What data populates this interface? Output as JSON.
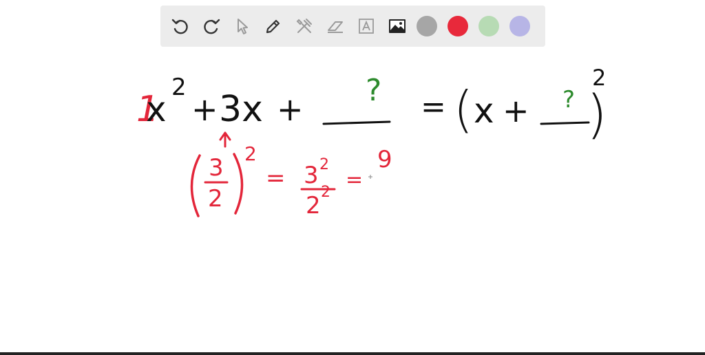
{
  "toolbar": {
    "tools": [
      {
        "icon": "undo-icon"
      },
      {
        "icon": "redo-icon"
      },
      {
        "icon": "select-pointer-icon"
      },
      {
        "icon": "pencil-icon"
      },
      {
        "icon": "tools-icon"
      },
      {
        "icon": "eraser-icon"
      },
      {
        "icon": "text-box-icon"
      },
      {
        "icon": "image-icon"
      }
    ],
    "colors": [
      "#a6a6a6",
      "#e8293b",
      "#b7dbb4",
      "#b7b5e6"
    ]
  },
  "canvas": {
    "ink_black": "#111111",
    "ink_red": "#e3263a",
    "ink_green": "#2e8b2e",
    "line1": {
      "coef": "1",
      "x": "x",
      "exp": "2",
      "plus1": "+",
      "three_x": "3x",
      "plus2": "+",
      "blank_mark": "?",
      "equals": "=",
      "paren_open": "(",
      "x2": "x",
      "plus3": "+",
      "blank_mark2": "?",
      "paren_close": ")",
      "exp2": "2"
    },
    "line2": {
      "num": "3",
      "den": "2",
      "exp": "2",
      "eq1": "=",
      "num2": "3",
      "num2_exp": "2",
      "den2": "2",
      "den2_exp": "2",
      "eq2": "=",
      "result": "9"
    }
  }
}
